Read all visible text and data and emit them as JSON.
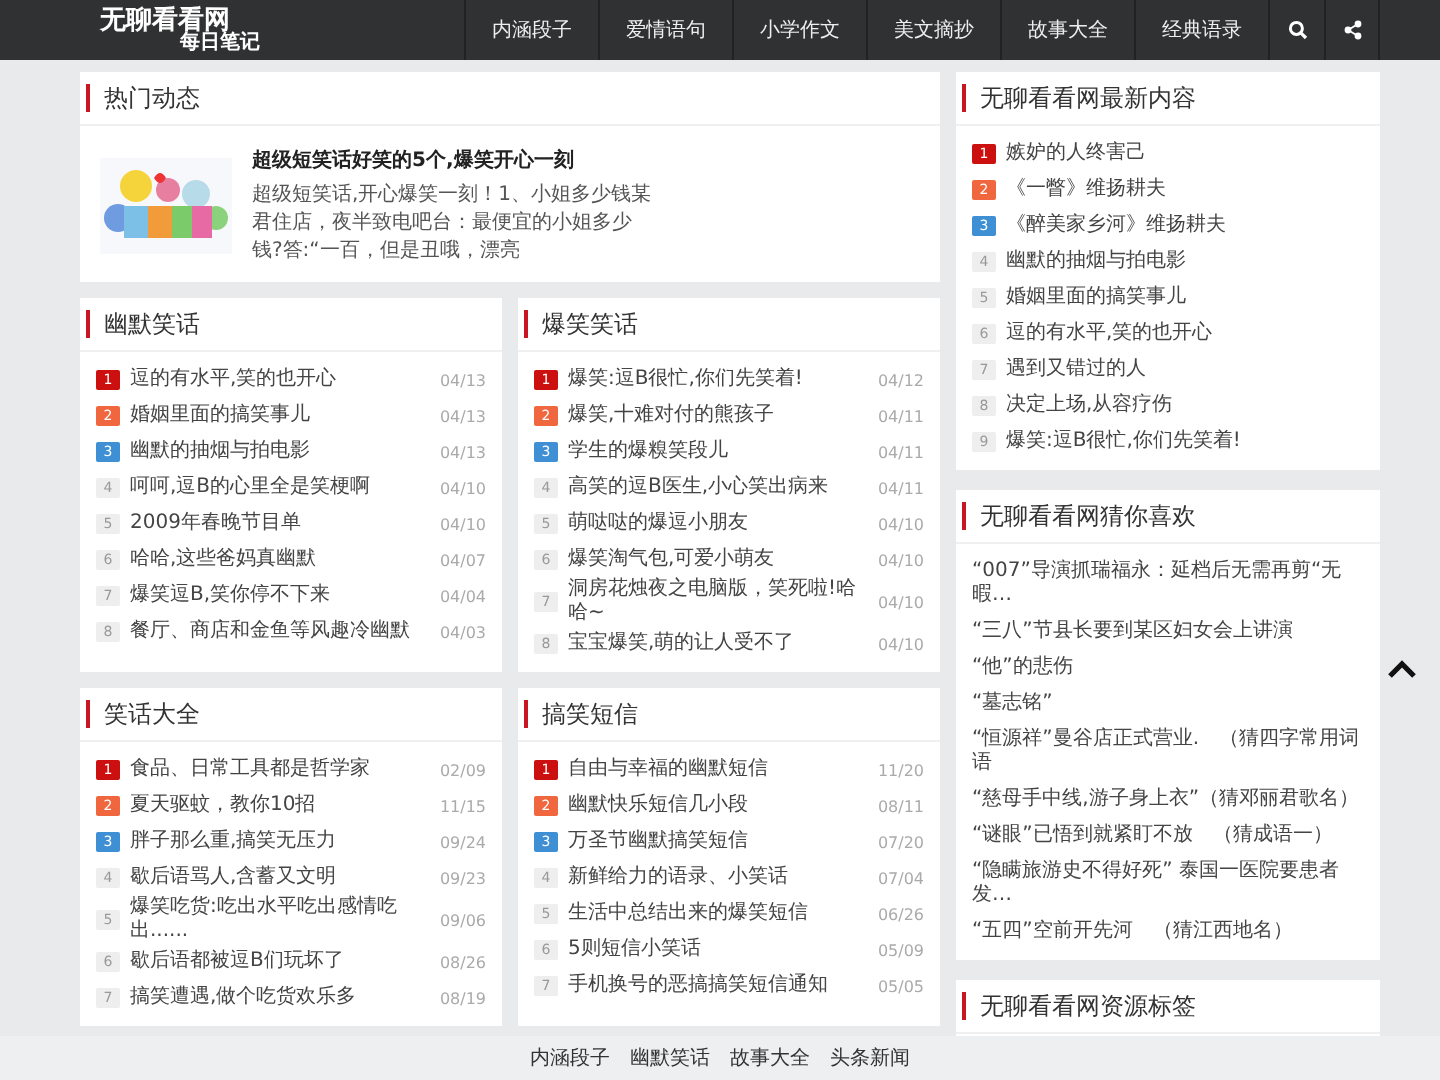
{
  "header": {
    "logo_title": "无聊看看网",
    "logo_subtitle": "每日笔记",
    "nav": [
      {
        "label": "内涵段子"
      },
      {
        "label": "爱情语句"
      },
      {
        "label": "小学作文"
      },
      {
        "label": "美文摘抄"
      },
      {
        "label": "故事大全"
      },
      {
        "label": "经典语录"
      }
    ],
    "icons": [
      {
        "kind": "search"
      },
      {
        "kind": "share"
      }
    ]
  },
  "hot": {
    "title": "热门动态",
    "article": {
      "kind": "picture",
      "title": "超级短笑话好笑的5个,爆笑开心一刻",
      "excerpt": "超级短笑话,开心爆笑一刻！1、小姐多少钱某君住店，夜半致电吧台：最便宜的小姐多少钱?答:“一百，但是丑哦，漂亮"
    }
  },
  "sections": [
    {
      "title": "幽默笑话",
      "items": [
        {
          "rank": "1",
          "color": "#cc1010",
          "text": "逗的有水平,笑的也开心",
          "date": "04/13"
        },
        {
          "rank": "2",
          "color": "#f0663f",
          "text": "婚姻里面的搞笑事儿",
          "date": "04/13"
        },
        {
          "rank": "3",
          "color": "#3f8fd5",
          "text": "幽默的抽烟与拍电影",
          "date": "04/13"
        },
        {
          "rank": "4",
          "color": "#eeeeee",
          "text": "呵呵,逗B的心里全是笑梗啊",
          "date": "04/10"
        },
        {
          "rank": "5",
          "color": "#eeeeee",
          "text": "2009年春晚节目单",
          "date": "04/10"
        },
        {
          "rank": "6",
          "color": "#eeeeee",
          "text": "哈哈,这些爸妈真幽默",
          "date": "04/07"
        },
        {
          "rank": "7",
          "color": "#eeeeee",
          "text": "爆笑逗B,笑你停不下来",
          "date": "04/04"
        },
        {
          "rank": "8",
          "color": "#eeeeee",
          "text": "餐厅、商店和金鱼等风趣冷幽默",
          "date": "04/03"
        }
      ]
    },
    {
      "title": "爆笑笑话",
      "items": [
        {
          "rank": "1",
          "color": "#cc1010",
          "text": "爆笑:逗B很忙,你们先笑着!",
          "date": "04/12"
        },
        {
          "rank": "2",
          "color": "#f0663f",
          "text": "爆笑,十难对付的熊孩子",
          "date": "04/11"
        },
        {
          "rank": "3",
          "color": "#3f8fd5",
          "text": "学生的爆糗笑段儿",
          "date": "04/11"
        },
        {
          "rank": "4",
          "color": "#eeeeee",
          "text": "高笑的逗B医生,小心笑出病来",
          "date": "04/11"
        },
        {
          "rank": "5",
          "color": "#eeeeee",
          "text": "萌哒哒的爆逗小朋友",
          "date": "04/10"
        },
        {
          "rank": "6",
          "color": "#eeeeee",
          "text": "爆笑淘气包,可爱小萌友",
          "date": "04/10"
        },
        {
          "rank": "7",
          "color": "#eeeeee",
          "text": "洞房花烛夜之电脑版，笑死啦!哈哈~",
          "date": "04/10"
        },
        {
          "rank": "8",
          "color": "#eeeeee",
          "text": "宝宝爆笑,萌的让人受不了",
          "date": "04/10"
        }
      ]
    },
    {
      "title": "笑话大全",
      "items": [
        {
          "rank": "1",
          "color": "#cc1010",
          "text": "食品、日常工具都是哲学家",
          "date": "02/09"
        },
        {
          "rank": "2",
          "color": "#f0663f",
          "text": "夏天驱蚊，教你10招",
          "date": "11/15"
        },
        {
          "rank": "3",
          "color": "#3f8fd5",
          "text": "胖子那么重,搞笑无压力",
          "date": "09/24"
        },
        {
          "rank": "4",
          "color": "#eeeeee",
          "text": "歇后语骂人,含蓄又文明",
          "date": "09/23"
        },
        {
          "rank": "5",
          "color": "#eeeeee",
          "text": "爆笑吃货:吃出水平吃出感情吃出......",
          "date": "09/06"
        },
        {
          "rank": "6",
          "color": "#eeeeee",
          "text": "歇后语都被逗B们玩坏了",
          "date": "08/26"
        },
        {
          "rank": "7",
          "color": "#eeeeee",
          "text": "搞笑遭遇,做个吃货欢乐多",
          "date": "08/19"
        }
      ]
    },
    {
      "title": "搞笑短信",
      "items": [
        {
          "rank": "1",
          "color": "#cc1010",
          "text": "自由与幸福的幽默短信",
          "date": "11/20"
        },
        {
          "rank": "2",
          "color": "#f0663f",
          "text": "幽默快乐短信几小段",
          "date": "08/11"
        },
        {
          "rank": "3",
          "color": "#3f8fd5",
          "text": "万圣节幽默搞笑短信",
          "date": "07/20"
        },
        {
          "rank": "4",
          "color": "#eeeeee",
          "text": "新鲜给力的语录、小笑话",
          "date": "07/04"
        },
        {
          "rank": "5",
          "color": "#eeeeee",
          "text": "生活中总结出来的爆笑短信",
          "date": "06/26"
        },
        {
          "rank": "6",
          "color": "#eeeeee",
          "text": "5则短信小笑话",
          "date": "05/09"
        },
        {
          "rank": "7",
          "color": "#eeeeee",
          "text": "手机换号的恶搞搞笑短信通知",
          "date": "05/05"
        }
      ]
    }
  ],
  "sidebar": [
    {
      "title": "无聊看看网最新内容",
      "kind": "ranked",
      "items": [
        {
          "rank": "1",
          "color": "#cc1010",
          "text": "嫉妒的人终害己"
        },
        {
          "rank": "2",
          "color": "#f0663f",
          "text": "《一瞥》维扬耕夫"
        },
        {
          "rank": "3",
          "color": "#3f8fd5",
          "text": "《醉美家乡河》维扬耕夫"
        },
        {
          "rank": "4",
          "color": "#eeeeee",
          "text": "幽默的抽烟与拍电影"
        },
        {
          "rank": "5",
          "color": "#eeeeee",
          "text": "婚姻里面的搞笑事儿"
        },
        {
          "rank": "6",
          "color": "#eeeeee",
          "text": "逗的有水平,笑的也开心"
        },
        {
          "rank": "7",
          "color": "#eeeeee",
          "text": "遇到又错过的人"
        },
        {
          "rank": "8",
          "color": "#eeeeee",
          "text": "决定上场,从容疗伤"
        },
        {
          "rank": "9",
          "color": "#eeeeee",
          "text": "爆笑:逗B很忙,你们先笑着!"
        }
      ]
    },
    {
      "title": "无聊看看网猜你喜欢",
      "kind": "plain",
      "items": [
        {
          "text": "“007”导演抓瑞福永：延档后无需再剪“无暇…"
        },
        {
          "text": "“三八”节县长要到某区妇女会上讲演"
        },
        {
          "text": "“他”的悲伤"
        },
        {
          "text": "“墓志铭”"
        },
        {
          "text": "“恒源祥”曼谷店正式营业.　（猜四字常用词语"
        },
        {
          "text": "“慈母手中线,游子身上衣”（猜邓丽君歌名）"
        },
        {
          "text": "“谜眼”已悟到就紧盯不放　（猜成语一）"
        },
        {
          "text": "“隐瞒旅游史不得好死” 泰国一医院要患者发…"
        },
        {
          "text": "“五四”空前开先河　（猜江西地名）"
        }
      ]
    },
    {
      "title": "无聊看看网资源标签",
      "kind": "plain"
    }
  ],
  "footer": {
    "links": [
      {
        "label": "内涵段子"
      },
      {
        "label": "幽默笑话"
      },
      {
        "label": "故事大全"
      },
      {
        "label": "头条新闻"
      }
    ]
  }
}
